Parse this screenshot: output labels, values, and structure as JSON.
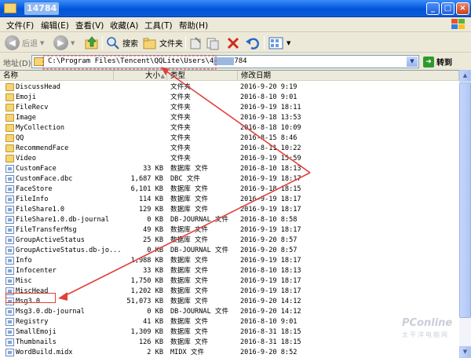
{
  "window": {
    "title": "14784"
  },
  "menu": [
    "文件(F)",
    "编辑(E)",
    "查看(V)",
    "收藏(A)",
    "工具(T)",
    "帮助(H)"
  ],
  "toolbar": {
    "back": "后退",
    "search": "搜索",
    "folders": "文件夹"
  },
  "address": {
    "label": "地址(D)",
    "value": "C:\\Program Files\\Tencent\\QQLite\\Users\\4",
    "masked": "784",
    "go": "转到"
  },
  "columns": {
    "name": "名称",
    "size": "大小",
    "type": "类型",
    "date": "修改日期"
  },
  "files": [
    {
      "name": "DiscussHead",
      "size": "",
      "type": "文件夹",
      "date": "2016-9-20 9:19",
      "kind": "folder"
    },
    {
      "name": "Emoji",
      "size": "",
      "type": "文件夹",
      "date": "2016-8-10 9:01",
      "kind": "folder"
    },
    {
      "name": "FileRecv",
      "size": "",
      "type": "文件夹",
      "date": "2016-9-19 18:11",
      "kind": "folder"
    },
    {
      "name": "Image",
      "size": "",
      "type": "文件夹",
      "date": "2016-9-18 13:53",
      "kind": "folder"
    },
    {
      "name": "MyCollection",
      "size": "",
      "type": "文件夹",
      "date": "2016-8-18 10:09",
      "kind": "folder"
    },
    {
      "name": "QQ",
      "size": "",
      "type": "文件夹",
      "date": "2016-8-15 8:46",
      "kind": "folder"
    },
    {
      "name": "RecommendFace",
      "size": "",
      "type": "文件夹",
      "date": "2016-8-11 10:22",
      "kind": "folder"
    },
    {
      "name": "Video",
      "size": "",
      "type": "文件夹",
      "date": "2016-9-19 15:59",
      "kind": "folder"
    },
    {
      "name": "CustomFace",
      "size": "33 KB",
      "type": "数据库 文件",
      "date": "2016-8-10 18:13",
      "kind": "file"
    },
    {
      "name": "CustomFace.dbc",
      "size": "1,687 KB",
      "type": "DBC 文件",
      "date": "2016-9-19 18:17",
      "kind": "file"
    },
    {
      "name": "FaceStore",
      "size": "6,101 KB",
      "type": "数据库 文件",
      "date": "2016-9-18 18:15",
      "kind": "file"
    },
    {
      "name": "FileInfo",
      "size": "114 KB",
      "type": "数据库 文件",
      "date": "2016-9-19 18:17",
      "kind": "file"
    },
    {
      "name": "FileShare1.0",
      "size": "129 KB",
      "type": "数据库 文件",
      "date": "2016-9-19 18:17",
      "kind": "file"
    },
    {
      "name": "FileShare1.0.db-journal",
      "size": "0 KB",
      "type": "DB-JOURNAL 文件",
      "date": "2016-8-10 8:58",
      "kind": "file"
    },
    {
      "name": "FileTransferMsg",
      "size": "49 KB",
      "type": "数据库 文件",
      "date": "2016-9-19 18:17",
      "kind": "file"
    },
    {
      "name": "GroupActiveStatus",
      "size": "25 KB",
      "type": "数据库 文件",
      "date": "2016-9-20 8:57",
      "kind": "file"
    },
    {
      "name": "GroupActiveStatus.db-jo...",
      "size": "0 KB",
      "type": "DB-JOURNAL 文件",
      "date": "2016-9-20 8:57",
      "kind": "file"
    },
    {
      "name": "Info",
      "size": "1,988 KB",
      "type": "数据库 文件",
      "date": "2016-9-19 18:17",
      "kind": "file"
    },
    {
      "name": "Infocenter",
      "size": "33 KB",
      "type": "数据库 文件",
      "date": "2016-8-10 18:13",
      "kind": "file"
    },
    {
      "name": "Misc",
      "size": "1,750 KB",
      "type": "数据库 文件",
      "date": "2016-9-19 18:17",
      "kind": "file"
    },
    {
      "name": "MiscHead",
      "size": "1,202 KB",
      "type": "数据库 文件",
      "date": "2016-9-19 18:17",
      "kind": "file"
    },
    {
      "name": "Msg3.0",
      "size": "51,073 KB",
      "type": "数据库 文件",
      "date": "2016-9-20 14:12",
      "kind": "file"
    },
    {
      "name": "Msg3.0.db-journal",
      "size": "0 KB",
      "type": "DB-JOURNAL 文件",
      "date": "2016-9-20 14:12",
      "kind": "file"
    },
    {
      "name": "Registry",
      "size": "41 KB",
      "type": "数据库 文件",
      "date": "2016-8-10 9:01",
      "kind": "file"
    },
    {
      "name": "SmallEmoji",
      "size": "1,309 KB",
      "type": "数据库 文件",
      "date": "2016-8-31 18:15",
      "kind": "file"
    },
    {
      "name": "Thumbnails",
      "size": "126 KB",
      "type": "数据库 文件",
      "date": "2016-8-31 18:15",
      "kind": "file"
    },
    {
      "name": "WordBuild.midx",
      "size": "2 KB",
      "type": "MIDX 文件",
      "date": "2016-9-20 8:52",
      "kind": "file"
    }
  ],
  "watermark": {
    "brand": "PConline",
    "sub": "太平洋电脑网"
  },
  "colors": {
    "annotation_red": "#E0413A",
    "title_blue": "#0A5FE0"
  }
}
